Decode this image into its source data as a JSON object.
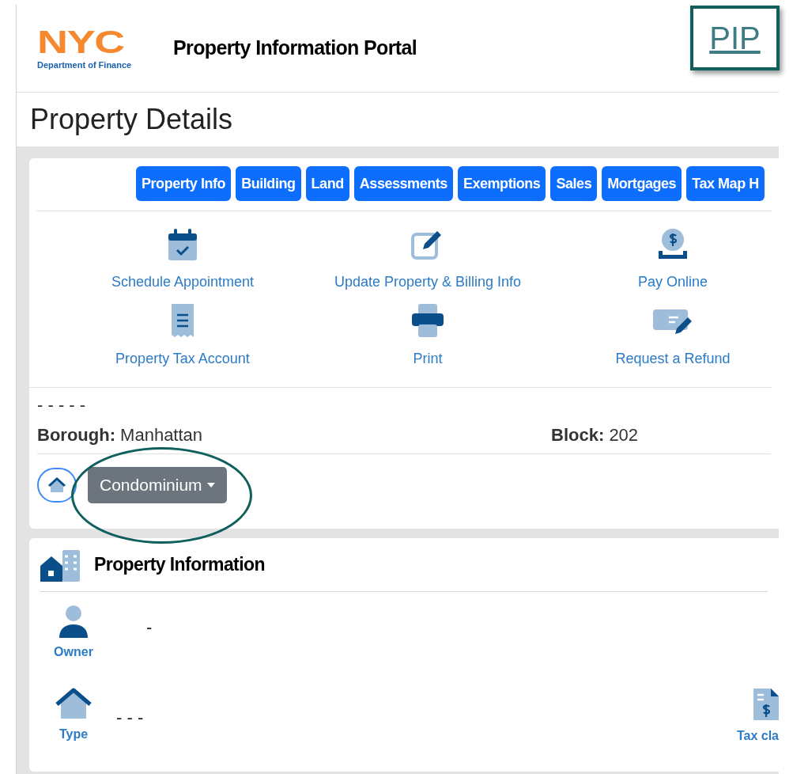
{
  "header": {
    "logo": {
      "wordmark": "NYC",
      "subtitle": "Department of Finance"
    },
    "title": "Property Information Portal"
  },
  "page_title": "Property Details",
  "tabs": [
    "Property Info",
    "Building",
    "Land",
    "Assessments",
    "Exemptions",
    "Sales",
    "Mortgages",
    "Tax Map H"
  ],
  "actions": [
    {
      "label": "Schedule Appointment",
      "kind": "calendar"
    },
    {
      "label": "Update Property & Billing Info",
      "kind": "edit"
    },
    {
      "label": "Pay Online",
      "kind": "pay"
    },
    {
      "label": "Property Tax Account",
      "kind": "receipt"
    },
    {
      "label": "Print",
      "kind": "print"
    },
    {
      "label": "Request a Refund",
      "kind": "refund"
    }
  ],
  "summary_placeholder": "- - - - -",
  "fields": [
    {
      "label": "Borough:",
      "value": "Manhattan"
    },
    {
      "label": "Block:",
      "value": "202"
    }
  ],
  "property_type_button": "Condominium",
  "property_information": {
    "title": "Property Information",
    "items": [
      {
        "label": "Owner",
        "value": "-",
        "kind": "person"
      },
      {
        "label": "Type",
        "value": "- - -",
        "kind": "house"
      }
    ],
    "side_item": {
      "label": "Tax cla"
    }
  },
  "annotation": {
    "badge": "PIP"
  }
}
